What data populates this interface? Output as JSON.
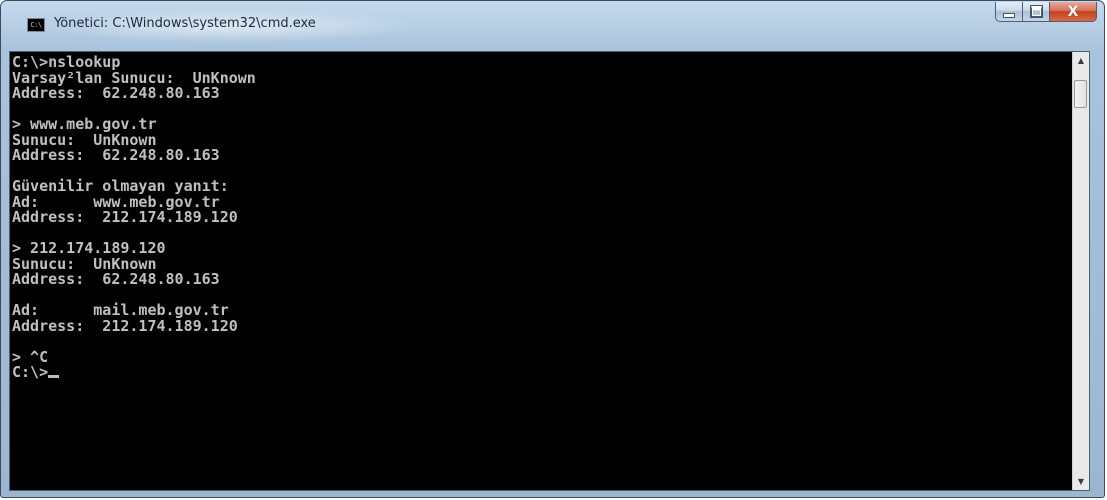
{
  "window": {
    "title": "Yönetici: C:\\Windows\\system32\\cmd.exe",
    "icon_text": "C:\\",
    "icon": "cmd-icon"
  },
  "caption_buttons": {
    "minimize_icon": "minimize-icon",
    "maximize_icon": "maximize-icon",
    "close_icon": "close-icon",
    "close_glyph": "X"
  },
  "console": {
    "foreground": "#c0c0c0",
    "background": "#000000",
    "lines": [
      "C:\\>nslookup",
      "Varsay²lan Sunucu:  UnKnown",
      "Address:  62.248.80.163",
      "",
      "> www.meb.gov.tr",
      "Sunucu:  UnKnown",
      "Address:  62.248.80.163",
      "",
      "Güvenilir olmayan yanıt:",
      "Ad:      www.meb.gov.tr",
      "Address:  212.174.189.120",
      "",
      "> 212.174.189.120",
      "Sunucu:  UnKnown",
      "Address:  62.248.80.163",
      "",
      "Ad:      mail.meb.gov.tr",
      "Address:  212.174.189.120",
      "",
      "> ^C",
      "C:\\>"
    ]
  },
  "scrollbar": {
    "up_icon": "scroll-up-arrow-icon",
    "down_icon": "scroll-down-arrow-icon",
    "up_glyph": "▲",
    "down_glyph": "▼"
  }
}
